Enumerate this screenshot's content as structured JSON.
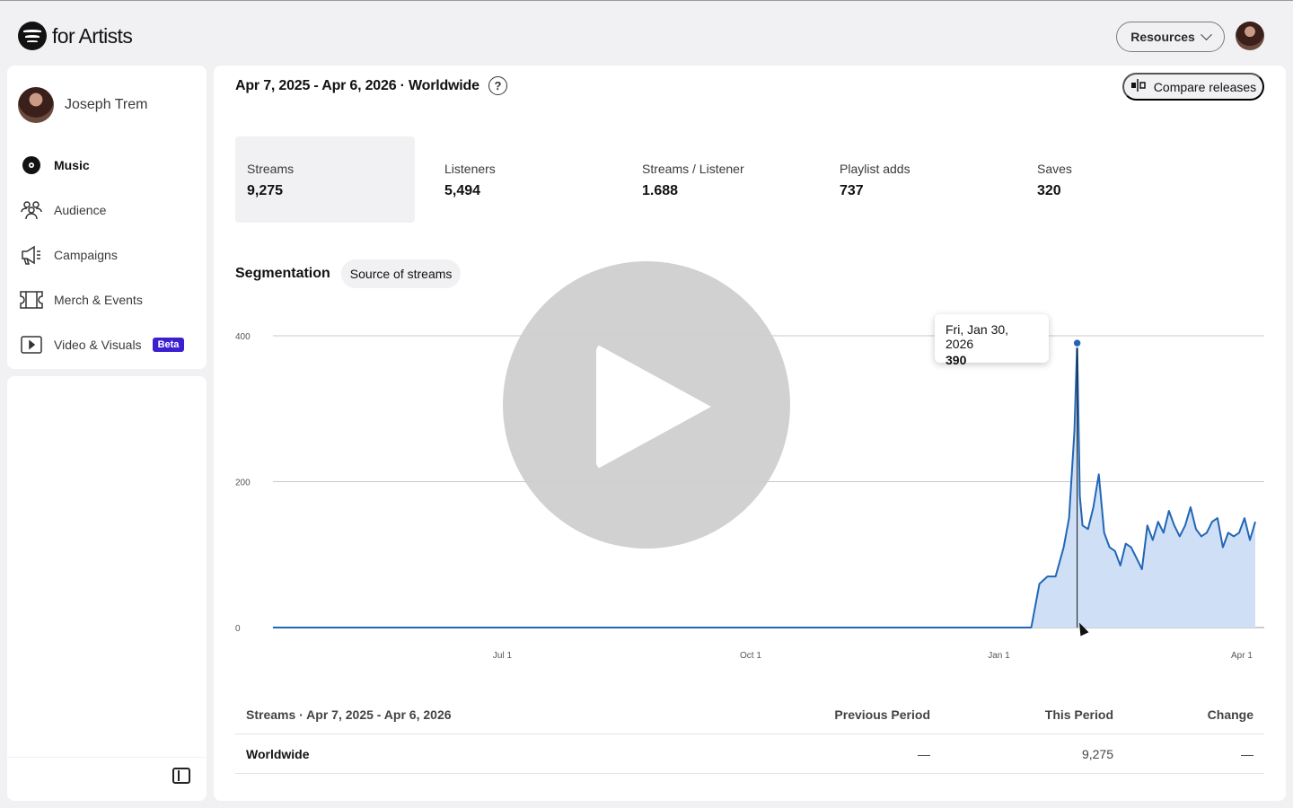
{
  "app": {
    "logo_text": "for Artists"
  },
  "header": {
    "resources_label": "Resources"
  },
  "sidebar": {
    "profile_name": "Joseph Trem",
    "items": [
      {
        "label": "Music",
        "icon": "music-disc-icon",
        "active": true
      },
      {
        "label": "Audience",
        "icon": "audience-icon"
      },
      {
        "label": "Campaigns",
        "icon": "megaphone-icon"
      },
      {
        "label": "Merch & Events",
        "icon": "ticket-icon"
      },
      {
        "label": "Video & Visuals",
        "icon": "video-icon",
        "badge": "Beta"
      }
    ]
  },
  "main": {
    "range_title": "Apr 7, 2025 - Apr 6, 2026 · Worldwide",
    "help_glyph": "?",
    "compare_label": "Compare releases",
    "metrics": [
      {
        "label": "Streams",
        "value": "9,275"
      },
      {
        "label": "Listeners",
        "value": "5,494"
      },
      {
        "label": "Streams / Listener",
        "value": "1.688"
      },
      {
        "label": "Playlist adds",
        "value": "737"
      },
      {
        "label": "Saves",
        "value": "320"
      }
    ],
    "segmentation_label": "Segmentation",
    "segmentation_chip": "Source of streams",
    "tooltip": {
      "date": "Fri, Jan 30, 2026",
      "value": "390"
    },
    "table": {
      "headers": [
        "Streams · Apr 7, 2025 - Apr 6, 2026",
        "Previous Period",
        "This Period",
        "Change"
      ],
      "rows": [
        {
          "label": "Worldwide",
          "previous": "—",
          "current": "9,275",
          "change": "—"
        }
      ]
    }
  },
  "colors": {
    "line": "#2266b5",
    "area": "#cfe0f6",
    "beta": "#3d1fd1"
  },
  "chart_data": {
    "type": "area",
    "ylim": [
      0,
      400
    ],
    "yticks": [
      "0",
      "200",
      "400"
    ],
    "xticks": [
      "Jul 1",
      "Oct 1",
      "Jan 1",
      "Apr 1"
    ],
    "series": [
      {
        "x": [
          "2025-04-07",
          "2026-01-13",
          "2026-01-16",
          "2026-01-19",
          "2026-01-22",
          "2026-01-25",
          "2026-01-27",
          "2026-01-29",
          "2026-01-30",
          "2026-01-31",
          "2026-02-01",
          "2026-02-03",
          "2026-02-05",
          "2026-02-07",
          "2026-02-09",
          "2026-02-11",
          "2026-02-13",
          "2026-02-15",
          "2026-02-17",
          "2026-02-19",
          "2026-02-21",
          "2026-02-23",
          "2026-02-25",
          "2026-02-27",
          "2026-03-01",
          "2026-03-03",
          "2026-03-05",
          "2026-03-07",
          "2026-03-09",
          "2026-03-11",
          "2026-03-13",
          "2026-03-15",
          "2026-03-17",
          "2026-03-19",
          "2026-03-21",
          "2026-03-23",
          "2026-03-25",
          "2026-03-27",
          "2026-03-29",
          "2026-03-31",
          "2026-04-02",
          "2026-04-04",
          "2026-04-06"
        ],
        "y": [
          0,
          0,
          60,
          70,
          70,
          110,
          150,
          270,
          390,
          180,
          140,
          135,
          165,
          210,
          130,
          110,
          105,
          85,
          115,
          110,
          95,
          80,
          140,
          120,
          145,
          130,
          160,
          140,
          125,
          140,
          165,
          135,
          125,
          130,
          145,
          150,
          110,
          130,
          125,
          130,
          150,
          120,
          145
        ]
      }
    ]
  }
}
